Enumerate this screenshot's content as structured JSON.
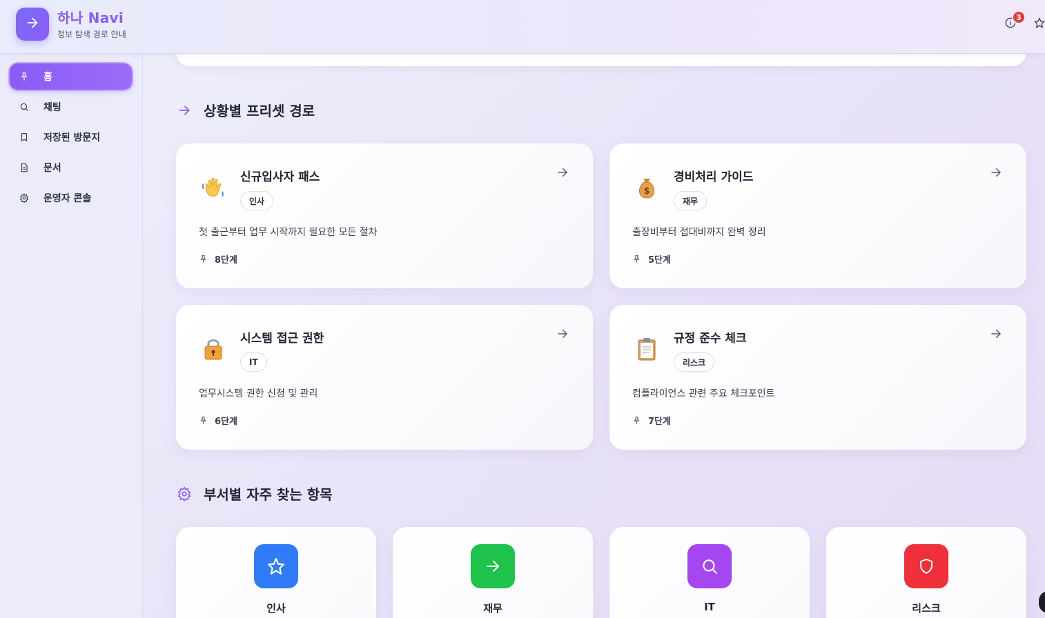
{
  "header": {
    "app_name": "하나 Navi",
    "subtitle": "정보 탐색 경로 안내",
    "notification_count": "3"
  },
  "sidebar": {
    "items": [
      {
        "label": "홈",
        "icon": "pin-icon",
        "active": true
      },
      {
        "label": "채팅",
        "icon": "search-icon",
        "active": false
      },
      {
        "label": "저장된 방문지",
        "icon": "bookmark-icon",
        "active": false
      },
      {
        "label": "문서",
        "icon": "document-icon",
        "active": false
      },
      {
        "label": "운영자 콘솔",
        "icon": "gear-icon",
        "active": false
      }
    ]
  },
  "presets": {
    "title": "상황별 프리셋 경로",
    "cards": [
      {
        "title": "신규입사자 패스",
        "tag": "인사",
        "description": "첫 출근부터 업무 시작까지 필요한 모든 절차",
        "steps": "8단계",
        "icon": "waving-hand-emoji"
      },
      {
        "title": "경비처리 가이드",
        "tag": "재무",
        "description": "출장비부터 접대비까지 완벽 정리",
        "steps": "5단계",
        "icon": "money-bag-emoji"
      },
      {
        "title": "시스템 접근 권한",
        "tag": "IT",
        "description": "업무시스템 권한 신청 및 관리",
        "steps": "6단계",
        "icon": "lock-emoji"
      },
      {
        "title": "규정 준수 체크",
        "tag": "리스크",
        "description": "컴플라이언스 관련 주요 체크포인트",
        "steps": "7단계",
        "icon": "clipboard-emoji"
      }
    ]
  },
  "departments": {
    "title": "부서별 자주 찾는 항목",
    "items": [
      {
        "label": "인사",
        "icon": "star-icon",
        "color": "#2f7cf6"
      },
      {
        "label": "재무",
        "icon": "arrow-right-icon",
        "color": "#1fc24a"
      },
      {
        "label": "IT",
        "icon": "search-icon",
        "color": "#a546f0"
      },
      {
        "label": "리스크",
        "icon": "shield-icon",
        "color": "#ef2f3a"
      }
    ]
  },
  "colors": {
    "accent": "#8b5cf6",
    "badge": "#e53939"
  }
}
